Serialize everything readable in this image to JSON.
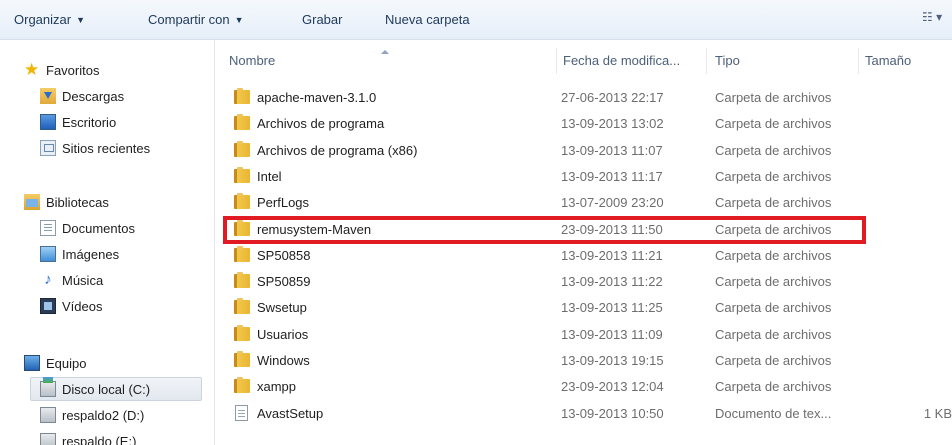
{
  "toolbar": {
    "organize": "Organizar",
    "share": "Compartir con",
    "burn": "Grabar",
    "new_folder": "Nueva carpeta",
    "views_icon": "view-options-icon"
  },
  "nav": {
    "favorites": {
      "label": "Favoritos",
      "items": [
        "Descargas",
        "Escritorio",
        "Sitios recientes"
      ]
    },
    "libraries": {
      "label": "Bibliotecas",
      "items": [
        "Documentos",
        "Imágenes",
        "Música",
        "Vídeos"
      ]
    },
    "computer": {
      "label": "Equipo",
      "items": [
        "Disco local (C:)",
        "respaldo2 (D:)",
        "respaldo (E:)"
      ],
      "selected": "Disco local (C:)"
    }
  },
  "columns": {
    "name": "Nombre",
    "date": "Fecha de modifica...",
    "type": "Tipo",
    "size": "Tamaño"
  },
  "files": [
    {
      "name": "apache-maven-3.1.0",
      "date": "27-06-2013 22:17",
      "type": "Carpeta de archivos",
      "size": "",
      "kind": "folder"
    },
    {
      "name": "Archivos de programa",
      "date": "13-09-2013 13:02",
      "type": "Carpeta de archivos",
      "size": "",
      "kind": "folder"
    },
    {
      "name": "Archivos de programa (x86)",
      "date": "13-09-2013 11:07",
      "type": "Carpeta de archivos",
      "size": "",
      "kind": "folder"
    },
    {
      "name": "Intel",
      "date": "13-09-2013 11:17",
      "type": "Carpeta de archivos",
      "size": "",
      "kind": "folder"
    },
    {
      "name": "PerfLogs",
      "date": "13-07-2009 23:20",
      "type": "Carpeta de archivos",
      "size": "",
      "kind": "folder"
    },
    {
      "name": "remusystem-Maven",
      "date": "23-09-2013 11:50",
      "type": "Carpeta de archivos",
      "size": "",
      "kind": "folder",
      "highlighted": true
    },
    {
      "name": "SP50858",
      "date": "13-09-2013 11:21",
      "type": "Carpeta de archivos",
      "size": "",
      "kind": "folder"
    },
    {
      "name": "SP50859",
      "date": "13-09-2013 11:22",
      "type": "Carpeta de archivos",
      "size": "",
      "kind": "folder"
    },
    {
      "name": "Swsetup",
      "date": "13-09-2013 11:25",
      "type": "Carpeta de archivos",
      "size": "",
      "kind": "folder"
    },
    {
      "name": "Usuarios",
      "date": "13-09-2013 11:09",
      "type": "Carpeta de archivos",
      "size": "",
      "kind": "folder"
    },
    {
      "name": "Windows",
      "date": "13-09-2013 19:15",
      "type": "Carpeta de archivos",
      "size": "",
      "kind": "folder"
    },
    {
      "name": "xampp",
      "date": "23-09-2013 12:04",
      "type": "Carpeta de archivos",
      "size": "",
      "kind": "folder"
    },
    {
      "name": "AvastSetup",
      "date": "13-09-2013 10:50",
      "type": "Documento de tex...",
      "size": "1 KB",
      "kind": "file"
    }
  ],
  "colors": {
    "highlight": "#e01b22",
    "toolbar_text": "#1e395b"
  }
}
